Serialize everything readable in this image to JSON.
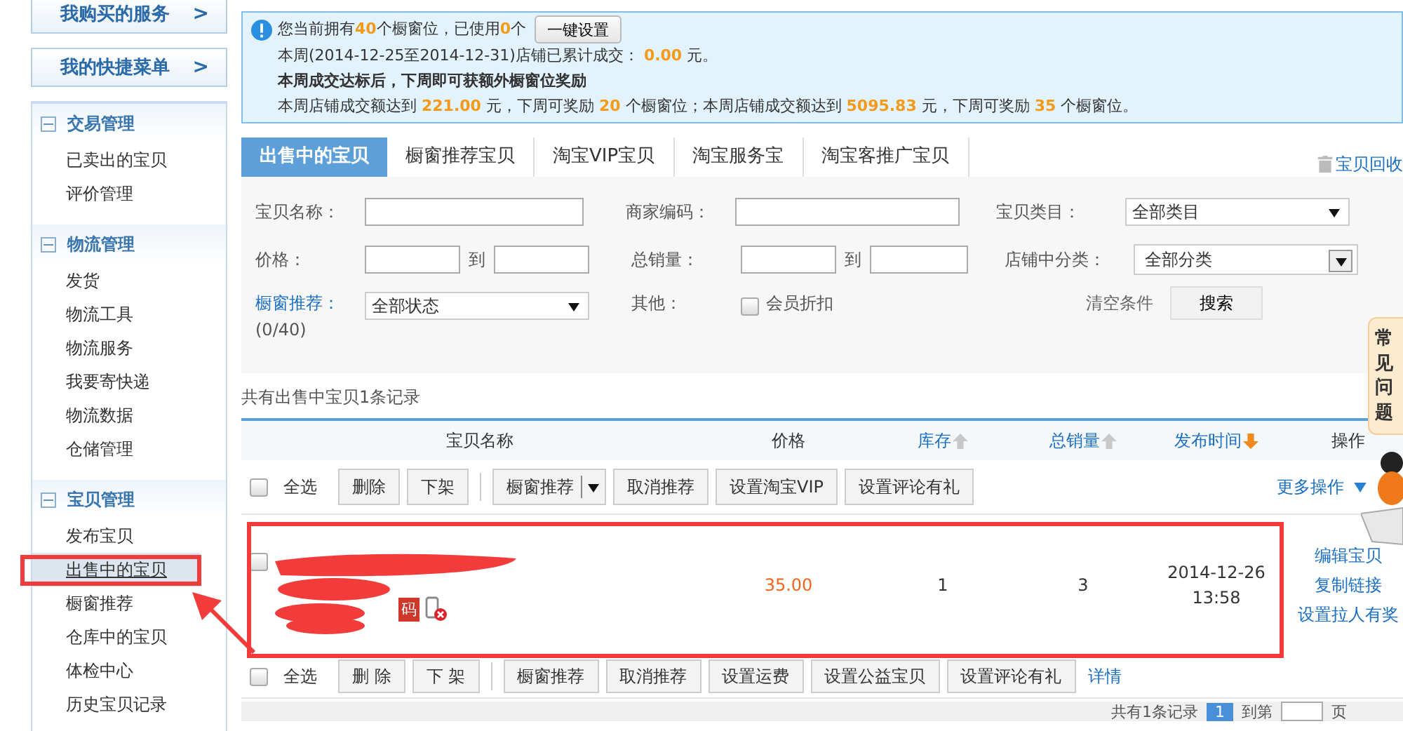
{
  "sidebar": {
    "top_buttons": [
      {
        "label": "我购买的服务",
        "arrow": ">"
      },
      {
        "label": "我的快捷菜单",
        "arrow": ">"
      }
    ],
    "groups": [
      {
        "title": "交易管理",
        "expanded": true,
        "items": [
          {
            "label": "已卖出的宝贝",
            "selected": false
          },
          {
            "label": "评价管理",
            "selected": false
          }
        ]
      },
      {
        "title": "物流管理",
        "expanded": true,
        "items": [
          {
            "label": "发货",
            "selected": false
          },
          {
            "label": "物流工具",
            "selected": false
          },
          {
            "label": "物流服务",
            "selected": false
          },
          {
            "label": "我要寄快递",
            "selected": false
          },
          {
            "label": "物流数据",
            "selected": false
          },
          {
            "label": "仓储管理",
            "selected": false
          }
        ]
      },
      {
        "title": "宝贝管理",
        "expanded": true,
        "items": [
          {
            "label": "发布宝贝",
            "selected": false
          },
          {
            "label": "出售中的宝贝",
            "selected": true
          },
          {
            "label": "橱窗推荐",
            "selected": false
          },
          {
            "label": "仓库中的宝贝",
            "selected": false
          },
          {
            "label": "体检中心",
            "selected": false
          },
          {
            "label": "历史宝贝记录",
            "selected": false
          }
        ]
      }
    ]
  },
  "notice": {
    "lines": [
      {
        "text": "您当前拥有**40**个橱窗位，已使用**0**个",
        "kind": "normal"
      },
      {
        "text": "本周(2014-12-25至2014-12-31)店铺已累计成交： **0.00** 元。",
        "kind": "normal"
      },
      {
        "text": "本周成交达标后，下周即可获额外橱窗位奖励",
        "kind": "bold"
      },
      {
        "text": "本周店铺成交额达到 **221.00** 元，下周可奖励 **20** 个橱窗位；本周店铺成交额达到 **5095.83** 元，下周可奖励 **35** 个橱窗位。",
        "kind": "normal"
      }
    ],
    "button": "一键设置"
  },
  "tabs": [
    {
      "label": "出售中的宝贝",
      "selected": true
    },
    {
      "label": "橱窗推荐宝贝",
      "selected": false
    },
    {
      "label": "淘宝VIP宝贝",
      "selected": false
    },
    {
      "label": "淘宝服务宝",
      "selected": false
    },
    {
      "label": "淘宝客推广宝贝",
      "selected": false
    }
  ],
  "recycle_link": "宝贝回收",
  "filters": {
    "name": {
      "label": "宝贝名称："
    },
    "merchant_code": {
      "label": "商家编码："
    },
    "category": {
      "label": "宝贝类目：",
      "value": "全部类目"
    },
    "price": {
      "label": "价格：",
      "to": "到"
    },
    "sales": {
      "label": "总销量：",
      "to": "到"
    },
    "shop_category": {
      "label": "店铺中分类：",
      "value": "全部分类"
    },
    "window": {
      "label": "橱窗推荐：",
      "count": "(0/40)",
      "value": "全部状态"
    },
    "other": {
      "label": "其他：",
      "option": "会员折扣",
      "checked": false
    },
    "clear": "清空条件",
    "search": "搜索"
  },
  "summary": "共有出售中宝贝1条记录",
  "columns": [
    {
      "label": "宝贝名称",
      "kind": "plain"
    },
    {
      "label": "价格",
      "kind": "plain"
    },
    {
      "label": "库存",
      "kind": "sort-up"
    },
    {
      "label": "总销量",
      "kind": "sort-up"
    },
    {
      "label": "发布时间",
      "kind": "sort-down"
    },
    {
      "label": "操作",
      "kind": "plain"
    }
  ],
  "toolbar_top": {
    "select_all": "全选",
    "checked": false,
    "buttons": [
      {
        "label": "删除",
        "kind": "plain"
      },
      {
        "label": "下架",
        "kind": "plain"
      },
      {
        "label": "橱窗推荐",
        "kind": "split"
      },
      {
        "label": "取消推荐",
        "kind": "plain"
      },
      {
        "label": "设置淘宝VIP",
        "kind": "plain"
      },
      {
        "label": "设置评论有礼",
        "kind": "plain"
      }
    ],
    "more": "更多操作"
  },
  "row": {
    "checked": false,
    "code_badge": "码",
    "mobile_disabled": true,
    "price": "35.00",
    "stock": "1",
    "sales": "3",
    "date": "2014-12-26",
    "time": "13:58",
    "actions": [
      "编辑宝贝",
      "复制链接",
      "设置拉人有奖"
    ]
  },
  "toolbar_bottom": {
    "select_all": "全选",
    "checked": false,
    "buttons": [
      {
        "label": "删 除",
        "kind": "plain"
      },
      {
        "label": "下 架",
        "kind": "plain"
      },
      {
        "label": "橱窗推荐",
        "kind": "plain"
      },
      {
        "label": "取消推荐",
        "kind": "plain"
      },
      {
        "label": "设置运费",
        "kind": "plain"
      },
      {
        "label": "设置公益宝贝",
        "kind": "plain"
      },
      {
        "label": "设置评论有礼",
        "kind": "plain"
      }
    ],
    "details": "详情"
  },
  "pagination": {
    "total": "共有1条记录",
    "page": "1",
    "goto": "到第",
    "unit": "页"
  },
  "help": {
    "label": "常见问题"
  }
}
